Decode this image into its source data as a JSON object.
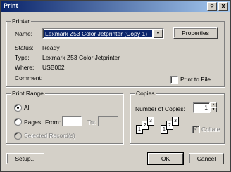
{
  "window": {
    "title": "Print",
    "help_label": "?",
    "close_label": "X"
  },
  "printer": {
    "group_label": "Printer",
    "name_label": "Name:",
    "name_value": "Lexmark Z53 Color Jetprinter (Copy 1)",
    "properties_label": "Properties",
    "status_label": "Status:",
    "status_value": "Ready",
    "type_label": "Type:",
    "type_value": "Lexmark Z53 Color Jetprinter",
    "where_label": "Where:",
    "where_value": "USB002",
    "comment_label": "Comment:",
    "comment_value": "",
    "print_to_file_label": "Print to File",
    "print_to_file_checked": false
  },
  "print_range": {
    "group_label": "Print Range",
    "all_label": "All",
    "all_selected": true,
    "pages_label": "Pages",
    "from_label": "From:",
    "from_value": "",
    "to_label": "To:",
    "to_value": "",
    "selected_records_label": "Selected Record(s)"
  },
  "copies": {
    "group_label": "Copies",
    "number_label": "Number of Copies:",
    "number_value": "1",
    "collate_label": "Collate",
    "collate_checked": true
  },
  "footer": {
    "setup_label": "Setup...",
    "ok_label": "OK",
    "cancel_label": "Cancel"
  },
  "icons": {
    "spin_up": "spin-up-icon",
    "spin_down": "spin-down-icon",
    "dropdown": "chevron-down-icon",
    "collate_pages": "collate-pages-icon"
  }
}
